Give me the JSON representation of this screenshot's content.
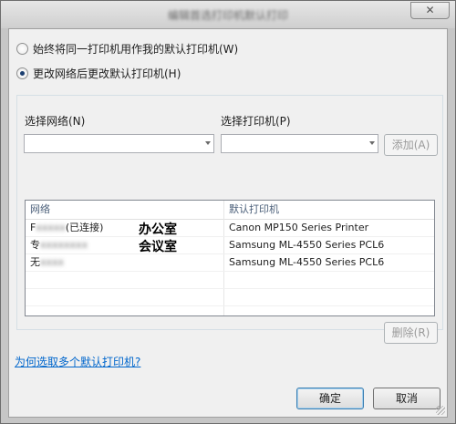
{
  "window": {
    "title": "编辑首选打印机默认打印",
    "close_glyph": "✕"
  },
  "options": {
    "always_same": "始终将同一打印机用作我的默认打印机(W)",
    "change_by_network": "更改网络后更改默认打印机(H)",
    "selected": "change_by_network"
  },
  "selectors": {
    "network_label": "选择网络(N)",
    "network_value": "",
    "printer_label": "选择打印机(P)",
    "printer_value": "",
    "add_button": "添加(A)"
  },
  "table": {
    "headers": [
      "网络",
      "默认打印机"
    ],
    "rows": [
      {
        "network_prefix": "F",
        "network_blurred": "xxxxx",
        "network_suffix": "(已连接)",
        "printer": "Canon MP150 Series Printer",
        "annotation": "办公室"
      },
      {
        "network_prefix": "专",
        "network_blurred": "xxxxxxxx",
        "network_suffix": "",
        "printer": "Samsung ML-4550 Series PCL6",
        "annotation": "会议室"
      },
      {
        "network_prefix": "无",
        "network_blurred": "xxxx",
        "network_suffix": "",
        "printer": "Samsung ML-4550 Series PCL6",
        "annotation": ""
      }
    ],
    "empty_rows": 2
  },
  "delete_button": "删除(R)",
  "help_link": "为何选取多个默认打印机?",
  "ok_button": "确定",
  "cancel_button": "取消"
}
